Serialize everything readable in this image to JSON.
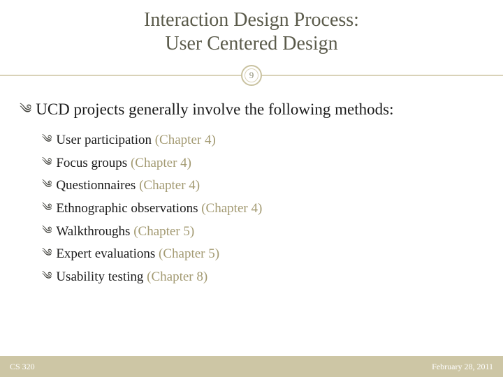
{
  "title": {
    "line1": "Interaction Design Process:",
    "line2": "User Centered Design"
  },
  "page_number": "9",
  "lead": "UCD projects generally involve the following methods:",
  "items": [
    {
      "text": "User participation",
      "chapter": "(Chapter 4)"
    },
    {
      "text": "Focus groups",
      "chapter": "(Chapter 4)"
    },
    {
      "text": "Questionnaires",
      "chapter": "(Chapter 4)"
    },
    {
      "text": "Ethnographic observations",
      "chapter": "(Chapter 4)"
    },
    {
      "text": "Walkthroughs",
      "chapter": "(Chapter 5)"
    },
    {
      "text": "Expert evaluations",
      "chapter": "(Chapter 5)"
    },
    {
      "text": "Usability testing ",
      "chapter": "(Chapter 8)"
    }
  ],
  "footer": {
    "left": "CS 320",
    "right": "February 28, 2011"
  },
  "bullet_glyph": "༄"
}
